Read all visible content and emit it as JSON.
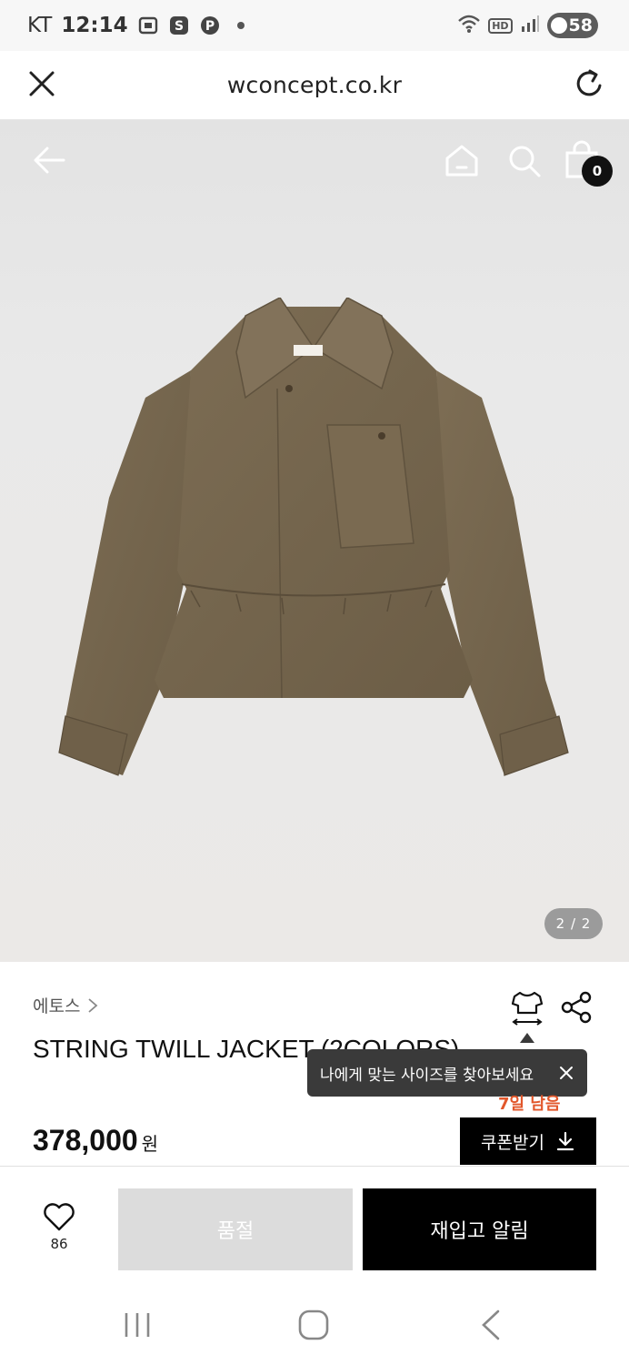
{
  "status_bar": {
    "carrier": "KT",
    "time": "12:14",
    "icons": [
      "screenshot-icon",
      "s-app-icon",
      "pinterest-icon",
      "notification-dot-icon"
    ],
    "right_icons": [
      "wifi-icon",
      "hd-icon",
      "signal-icon"
    ],
    "hd_label": "HD",
    "battery": "58"
  },
  "browser": {
    "url": "wconcept.co.kr"
  },
  "image_nav": {
    "bag_count": "0",
    "page_indicator": "2 / 2"
  },
  "product": {
    "brand": "에토스",
    "title": "STRING TWILL JACKET (2COLORS)",
    "price": "378,000",
    "currency": "원",
    "days_left": "7일 남음",
    "coupon_label": "쿠폰받기"
  },
  "tooltip": {
    "text": "나에게 맞는 사이즈를 찾아보세요"
  },
  "actions": {
    "like_count": "86",
    "soldout_label": "품절",
    "restock_label": "재입고 알림"
  },
  "colors": {
    "accent_orange": "#e2572b",
    "jacket_khaki": "#7a6a52"
  }
}
